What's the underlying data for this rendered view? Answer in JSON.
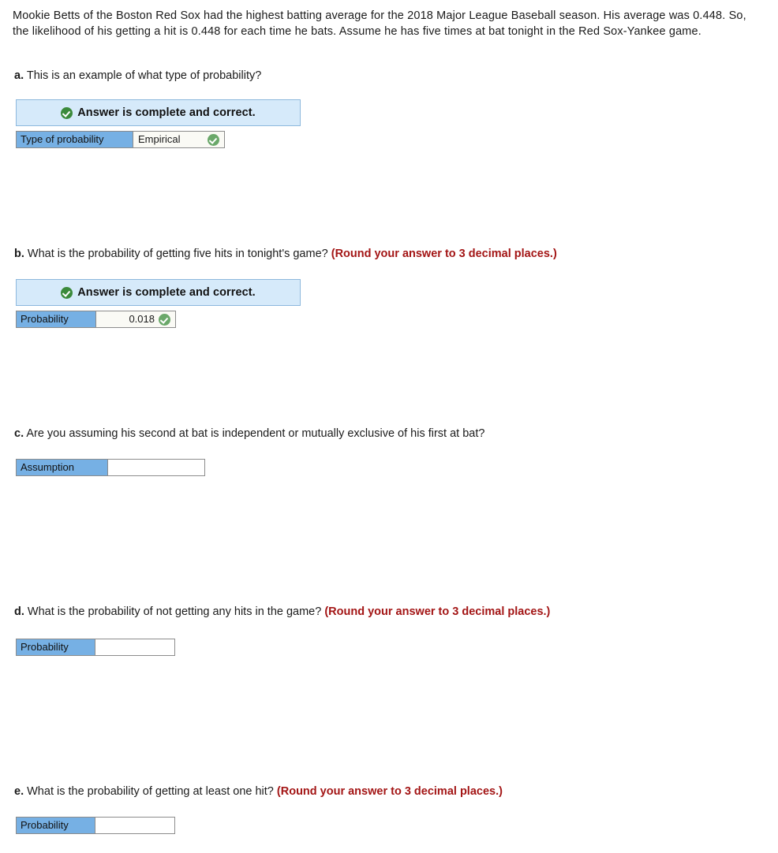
{
  "intro": {
    "text": "Mookie Betts of the Boston Red Sox had the highest batting average for the 2018 Major League Baseball season. His average was 0.448. So, the likelihood of his getting a hit is 0.448 for each time he bats. Assume he has five times at bat tonight in the Red Sox-Yankee game."
  },
  "colors": {
    "label_cell": "#76b0e4",
    "banner_background": "#d6eafa",
    "banner_border": "#8db8dd",
    "note_red": "#a31515",
    "check_green": "#3b8a3b",
    "cell_border": "#8c8c8c"
  },
  "banner": {
    "text": "Answer is complete and correct.",
    "icon": "check-circle-icon"
  },
  "parts": {
    "a": {
      "letter": "a.",
      "question": "This is an example of what type of probability?",
      "note": "",
      "banner_visible": true,
      "row": {
        "label": "Type of probability",
        "value": "Empirical",
        "status_icon": "check-circle-icon",
        "answered": true
      }
    },
    "b": {
      "letter": "b.",
      "question": "What is the probability of getting five hits in tonight's game?",
      "note": "(Round your answer to 3 decimal places.)",
      "banner_visible": true,
      "row": {
        "label": "Probability",
        "value": "0.018",
        "status_icon": "check-circle-icon",
        "answered": true
      }
    },
    "c": {
      "letter": "c.",
      "question": "Are you assuming his second at bat is independent or mutually exclusive of his first at bat?",
      "note": "",
      "banner_visible": false,
      "row": {
        "label": "Assumption",
        "value": "",
        "status_icon": "",
        "answered": false
      }
    },
    "d": {
      "letter": "d.",
      "question": "What is the probability of not getting any hits in the game?",
      "note": "(Round your answer to 3 decimal places.)",
      "banner_visible": false,
      "row": {
        "label": "Probability",
        "value": "",
        "status_icon": "",
        "answered": false
      }
    },
    "e": {
      "letter": "e.",
      "question": "What is the probability of getting at least one hit?",
      "note": "(Round your answer to 3 decimal places.)",
      "banner_visible": false,
      "row": {
        "label": "Probability",
        "value": "",
        "status_icon": "",
        "answered": false
      }
    }
  }
}
